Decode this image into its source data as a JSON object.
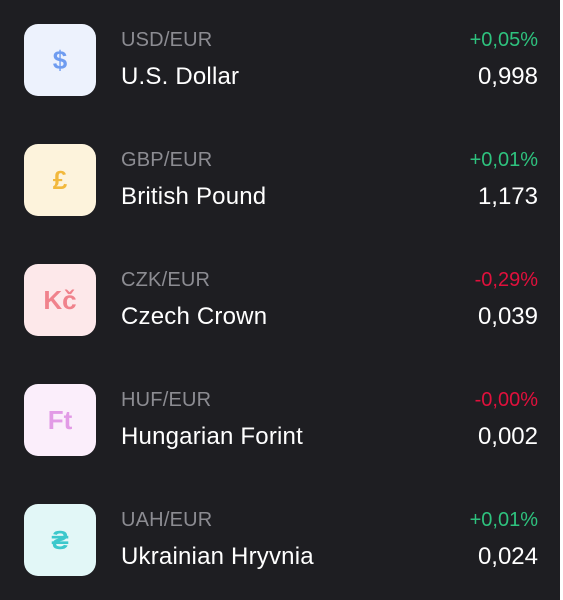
{
  "colors": {
    "background": "#1e1e22",
    "positive": "#2ec27e",
    "negative": "#e0103c"
  },
  "currencies": [
    {
      "icon_symbol": "$",
      "icon_name": "dollar-icon",
      "icon_fg": "#6f9cf0",
      "icon_bg": "#edf2fd",
      "pair": "USD/EUR",
      "name": "U.S. Dollar",
      "change": "+0,05%",
      "trend": "positive",
      "rate": "0,998"
    },
    {
      "icon_symbol": "£",
      "icon_name": "pound-icon",
      "icon_fg": "#f2b83c",
      "icon_bg": "#fdf3dc",
      "pair": "GBP/EUR",
      "name": "British Pound",
      "change": "+0,01%",
      "trend": "positive",
      "rate": "1,173"
    },
    {
      "icon_symbol": "Kč",
      "icon_name": "koruna-icon",
      "icon_fg": "#f0828c",
      "icon_bg": "#fde8ea",
      "pair": "CZK/EUR",
      "name": "Czech Crown",
      "change": "-0,29%",
      "trend": "negative",
      "rate": "0,039"
    },
    {
      "icon_symbol": "Ft",
      "icon_name": "forint-icon",
      "icon_fg": "#e29ae6",
      "icon_bg": "#fbeefb",
      "pair": "HUF/EUR",
      "name": "Hungarian Forint",
      "change": "-0,00%",
      "trend": "negative",
      "rate": "0,002"
    },
    {
      "icon_symbol": "₴",
      "icon_name": "hryvnia-icon",
      "icon_fg": "#3cc8cc",
      "icon_bg": "#e2f7f7",
      "pair": "UAH/EUR",
      "name": "Ukrainian Hryvnia",
      "change": "+0,01%",
      "trend": "positive",
      "rate": "0,024"
    }
  ]
}
